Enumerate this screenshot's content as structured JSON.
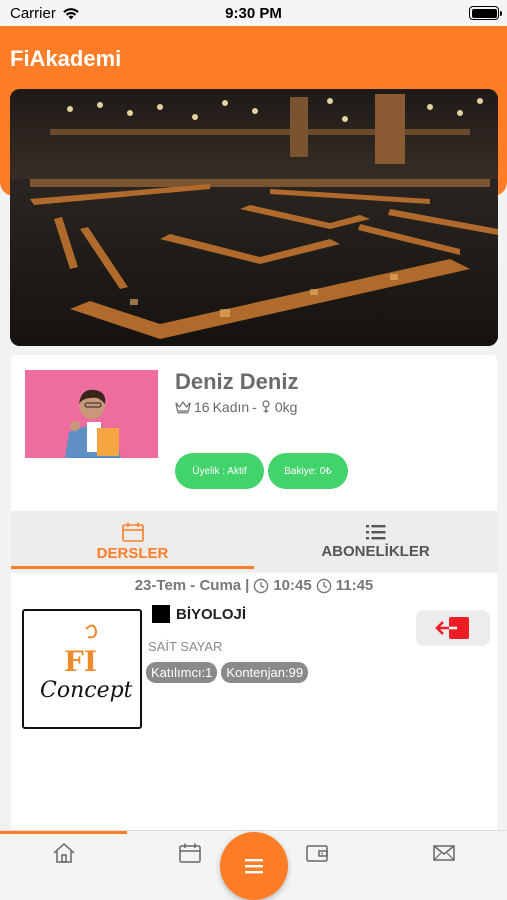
{
  "status_bar": {
    "carrier": "Carrier",
    "time": "9:30 PM"
  },
  "header": {
    "app_title": "FiAkademi"
  },
  "colors": {
    "brand": "#fe7d26",
    "active_green": "#42d46b",
    "chip_gray": "#8a8a8a",
    "exit_red": "#ee1c25"
  },
  "profile": {
    "name": "Deniz Deniz",
    "age": "16",
    "gender": "Kadın",
    "separator": "-",
    "weight": "0kg",
    "membership_badge": "Üyelik : Aktif",
    "balance_badge": "Bakiye: 0₺"
  },
  "tabs": [
    {
      "label": "DERSLER",
      "icon": "calendar-icon",
      "active": true
    },
    {
      "label": "ABONELİKLER",
      "icon": "list-icon",
      "active": false
    }
  ],
  "lessons": [
    {
      "date": "23-Tem - Cuma",
      "divider": "|",
      "start_time": "10:45",
      "end_time": "11:45",
      "title": "BİYOLOJİ",
      "teacher": "SAİT SAYAR",
      "participants_chip": "Katılımcı:1",
      "quota_chip": "Kontenjan:99",
      "logo_text_top": "FI",
      "logo_text_bottom": "Concept"
    }
  ],
  "bottom_nav": [
    "home-icon",
    "calendar-icon",
    "menu-icon",
    "wallet-icon",
    "mail-icon"
  ]
}
